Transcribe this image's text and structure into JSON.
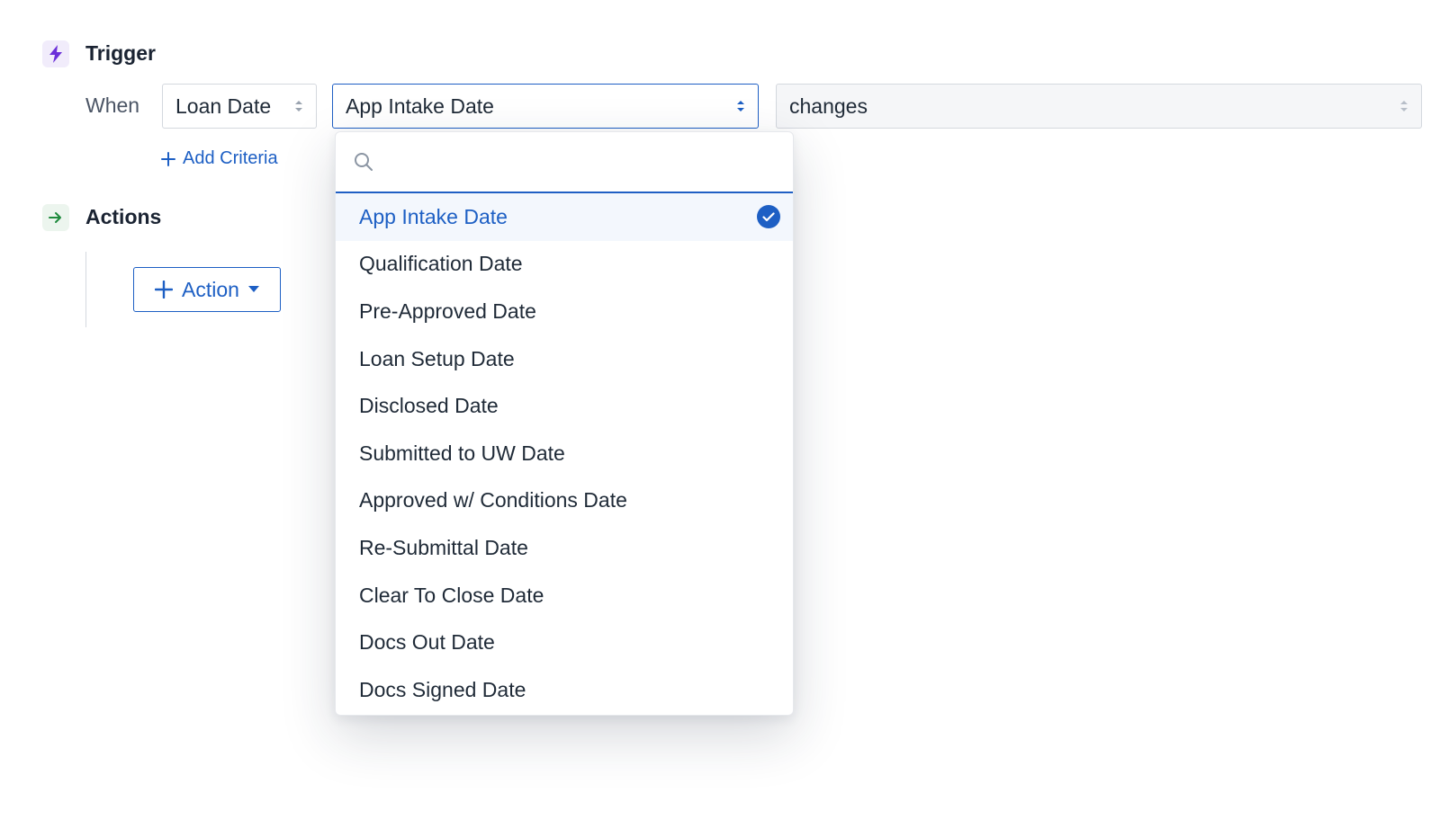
{
  "trigger": {
    "title": "Trigger",
    "when_label": "When",
    "source_select": {
      "value": "Loan Date"
    },
    "field_select": {
      "value": "App Intake Date"
    },
    "condition_select": {
      "value": "changes"
    },
    "add_criteria_label": "Add Criteria"
  },
  "actions": {
    "title": "Actions",
    "action_button_label": "Action"
  },
  "dropdown": {
    "search_placeholder": "",
    "selected_index": 0,
    "options": [
      "App Intake Date",
      "Qualification Date",
      "Pre-Approved Date",
      "Loan Setup Date",
      "Disclosed Date",
      "Submitted to UW Date",
      "Approved w/ Conditions Date",
      "Re-Submittal Date",
      "Clear To Close Date",
      "Docs Out Date",
      "Docs Signed Date"
    ]
  },
  "colors": {
    "accent": "#1d5fc4",
    "trigger_icon": "#6b2fd9",
    "actions_icon": "#1e8a3c",
    "selected_bg": "#f3f7fd"
  },
  "icons": {
    "trigger": "lightning-bolt-icon",
    "actions": "arrow-right-icon",
    "search": "search-icon",
    "selected": "check-circle-icon"
  }
}
